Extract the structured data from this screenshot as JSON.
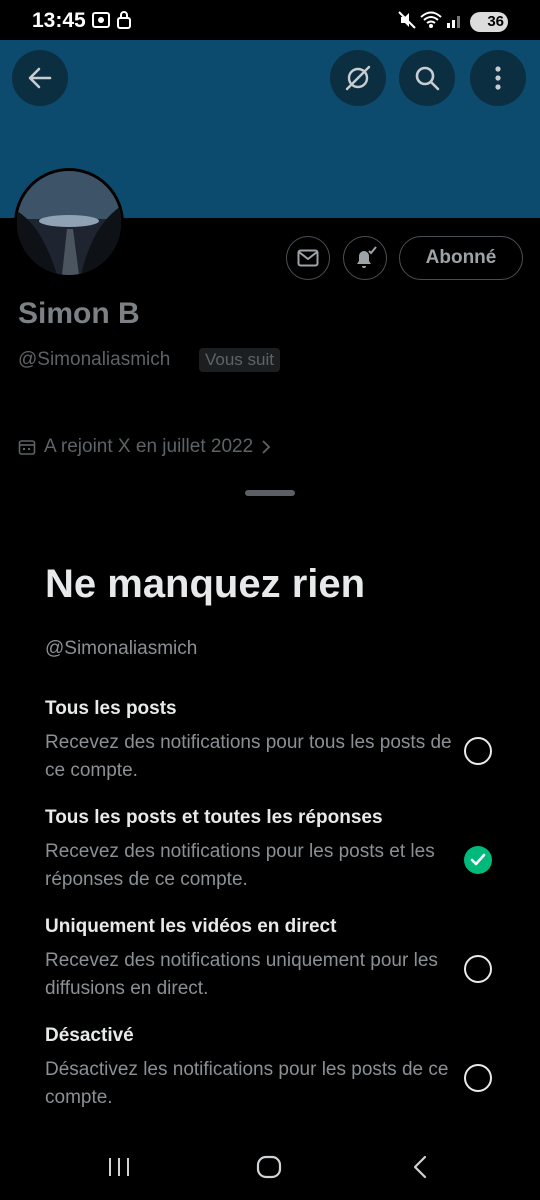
{
  "status_bar": {
    "time": "13:45",
    "battery": "36",
    "icons": [
      "screenshot-icon",
      "lock-icon",
      "mute-icon",
      "wifi-icon",
      "signal-icon",
      "battery-icon"
    ]
  },
  "header": {
    "back_icon": "arrow-left-icon",
    "actions": [
      "translate-off-icon",
      "search-icon",
      "more-vertical-icon"
    ]
  },
  "profile": {
    "name": "Simon B",
    "handle": "@Simonaliasmich",
    "follows_you": "Vous suit",
    "joined": "A rejoint X en juillet 2022",
    "subscribed_label": "Abonné",
    "message_icon": "mail-icon",
    "bell_icon": "bell-check-icon"
  },
  "sheet": {
    "title": "Ne manquez rien",
    "handle": "@Simonaliasmich",
    "options": [
      {
        "title": "Tous les posts",
        "description": "Recevez des notifications pour tous les posts de ce compte.",
        "selected": false
      },
      {
        "title": "Tous les posts et toutes les réponses",
        "description": "Recevez des notifications pour les posts et les réponses de ce compte.",
        "selected": true
      },
      {
        "title": "Uniquement les vidéos en direct",
        "description": "Recevez des notifications uniquement pour les diffusions en direct.",
        "selected": false
      },
      {
        "title": "Désactivé",
        "description": "Désactivez les notifications pour les posts de ce compte.",
        "selected": false
      }
    ]
  },
  "nav_bar": {
    "icons": [
      "recents-icon",
      "home-icon",
      "back-icon"
    ]
  },
  "colors": {
    "banner": "#0d4b6e",
    "accent_green": "#00ba7c",
    "background": "#000000"
  }
}
